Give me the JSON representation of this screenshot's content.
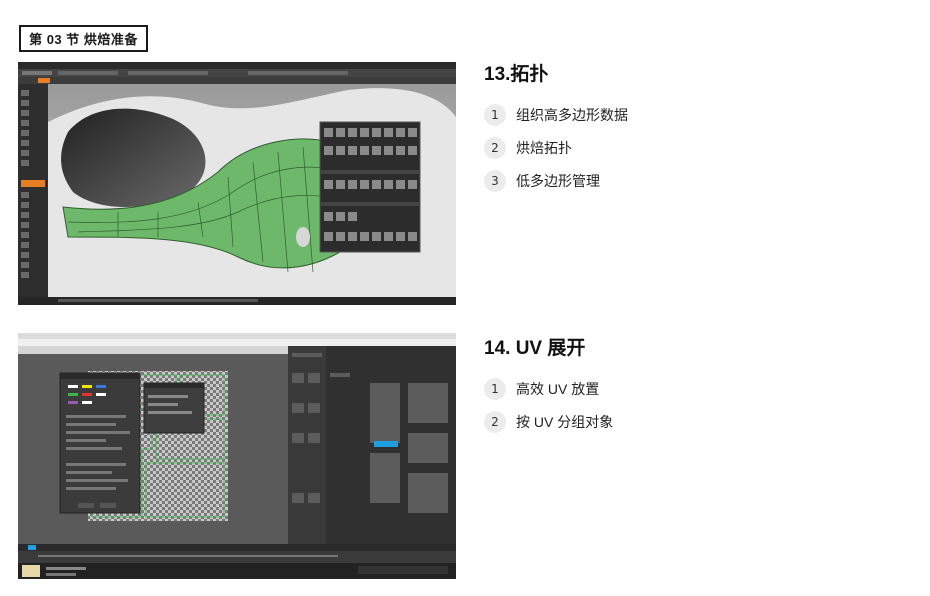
{
  "section_tag": "第 03 节 烘焙准备",
  "topics": [
    {
      "title": "13.拓扑",
      "items": [
        {
          "num": "1",
          "text": "组织高多边形数据"
        },
        {
          "num": "2",
          "text": "烘焙拓扑"
        },
        {
          "num": "3",
          "text": "低多边形管理"
        }
      ]
    },
    {
      "title": "14. UV 展开",
      "items": [
        {
          "num": "1",
          "text": "高效 UV 放置"
        },
        {
          "num": "2",
          "text": "按 UV 分组对象"
        }
      ]
    }
  ],
  "colors": {
    "mesh_green": "#6db86a",
    "app_dark": "#3a3a3a",
    "panel_dark": "#262626",
    "accent_orange": "#e67e22",
    "uv_blue": "#1f9fe0"
  }
}
